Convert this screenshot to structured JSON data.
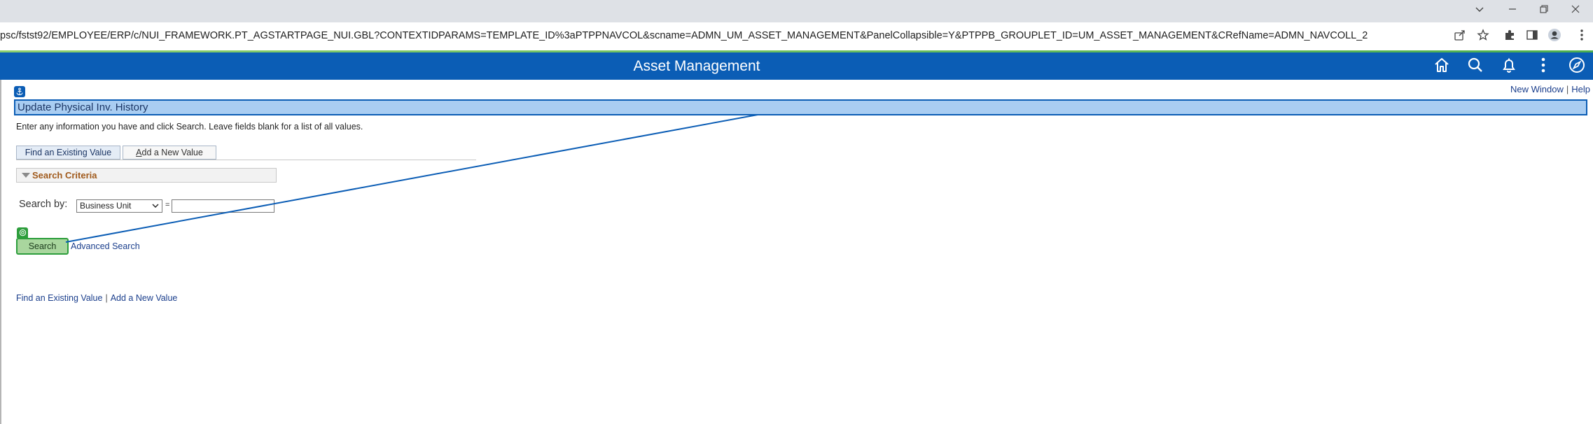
{
  "browser": {
    "url": "psc/fstst92/EMPLOYEE/ERP/c/NUI_FRAMEWORK.PT_AGSTARTPAGE_NUI.GBL?CONTEXTIDPARAMS=TEMPLATE_ID%3aPTPPNAVCOL&scname=ADMN_UM_ASSET_MANAGEMENT&PanelCollapsible=Y&PTPPB_GROUPLET_ID=UM_ASSET_MANAGEMENT&CRefName=ADMN_NAVCOLL_2",
    "window_controls": [
      "chevron-down-icon",
      "minimize-icon",
      "restore-icon",
      "close-icon"
    ],
    "toolbar_icons": [
      "share-icon",
      "star-icon",
      "extensions-icon",
      "sidepanel-icon",
      "profile-icon",
      "menu-icon"
    ]
  },
  "banner": {
    "title": "Asset Management",
    "icons": [
      "home-icon",
      "search-icon",
      "bell-icon",
      "actions-menu-icon",
      "navbar-icon"
    ],
    "color": "#0b5db5"
  },
  "page": {
    "top_links": {
      "new_window": "New Window",
      "help": "Help"
    },
    "title": "Update Physical Inv. History",
    "instructions": "Enter any information you have and click Search. Leave fields blank for a list of all values.",
    "tabs": [
      {
        "label": "Find an Existing Value",
        "active": true
      },
      {
        "label": "Add a New Value",
        "active": false
      }
    ],
    "search_criteria": {
      "label": "Search Criteria",
      "search_by_label": "Search by:",
      "search_by_value": "Business Unit",
      "operator": "=",
      "value": ""
    },
    "search_button": "Search",
    "advanced_search": "Advanced Search",
    "footer_links": {
      "find": "Find an Existing Value",
      "add": "Add a New Value"
    }
  },
  "colors": {
    "header_highlight": "#a9cdf2",
    "search_highlight": "#a9d69e",
    "section_label": "#a05a1c",
    "link": "#1a3e8c"
  }
}
